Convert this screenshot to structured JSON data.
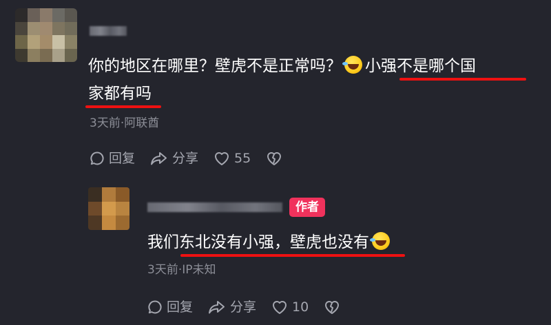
{
  "comments": [
    {
      "id": "comment-1",
      "text_line1_a": "你的地区在哪里？壁虎不是正常吗？",
      "text_line1_b": "小强不是哪个国",
      "text_line2": "家都有吗",
      "emoji_icon": "rofl-emoji-icon",
      "meta": "3天前·阿联酋",
      "actions": {
        "reply_label": "回复",
        "share_label": "分享",
        "like_count": "55",
        "reply_icon": "comment-bubble-icon",
        "share_icon": "share-arrow-icon",
        "like_icon": "heart-icon",
        "dislike_icon": "broken-heart-icon"
      }
    },
    {
      "id": "comment-2",
      "badge": "作者",
      "text_a": "我们",
      "text_b": "东北没有小强，壁虎也没有",
      "emoji_icon": "rofl-emoji-icon",
      "meta": "3天前·IP未知",
      "actions": {
        "reply_label": "回复",
        "share_label": "分享",
        "like_count": "10",
        "reply_icon": "comment-bubble-icon",
        "share_icon": "share-arrow-icon",
        "like_icon": "heart-icon",
        "dislike_icon": "broken-heart-icon"
      }
    }
  ],
  "colors": {
    "background": "#24252d",
    "text": "#ffffff",
    "meta": "#8c8e97",
    "badge": "#f0325c",
    "underline": "#ee1111",
    "action": "#a5a7b0"
  }
}
